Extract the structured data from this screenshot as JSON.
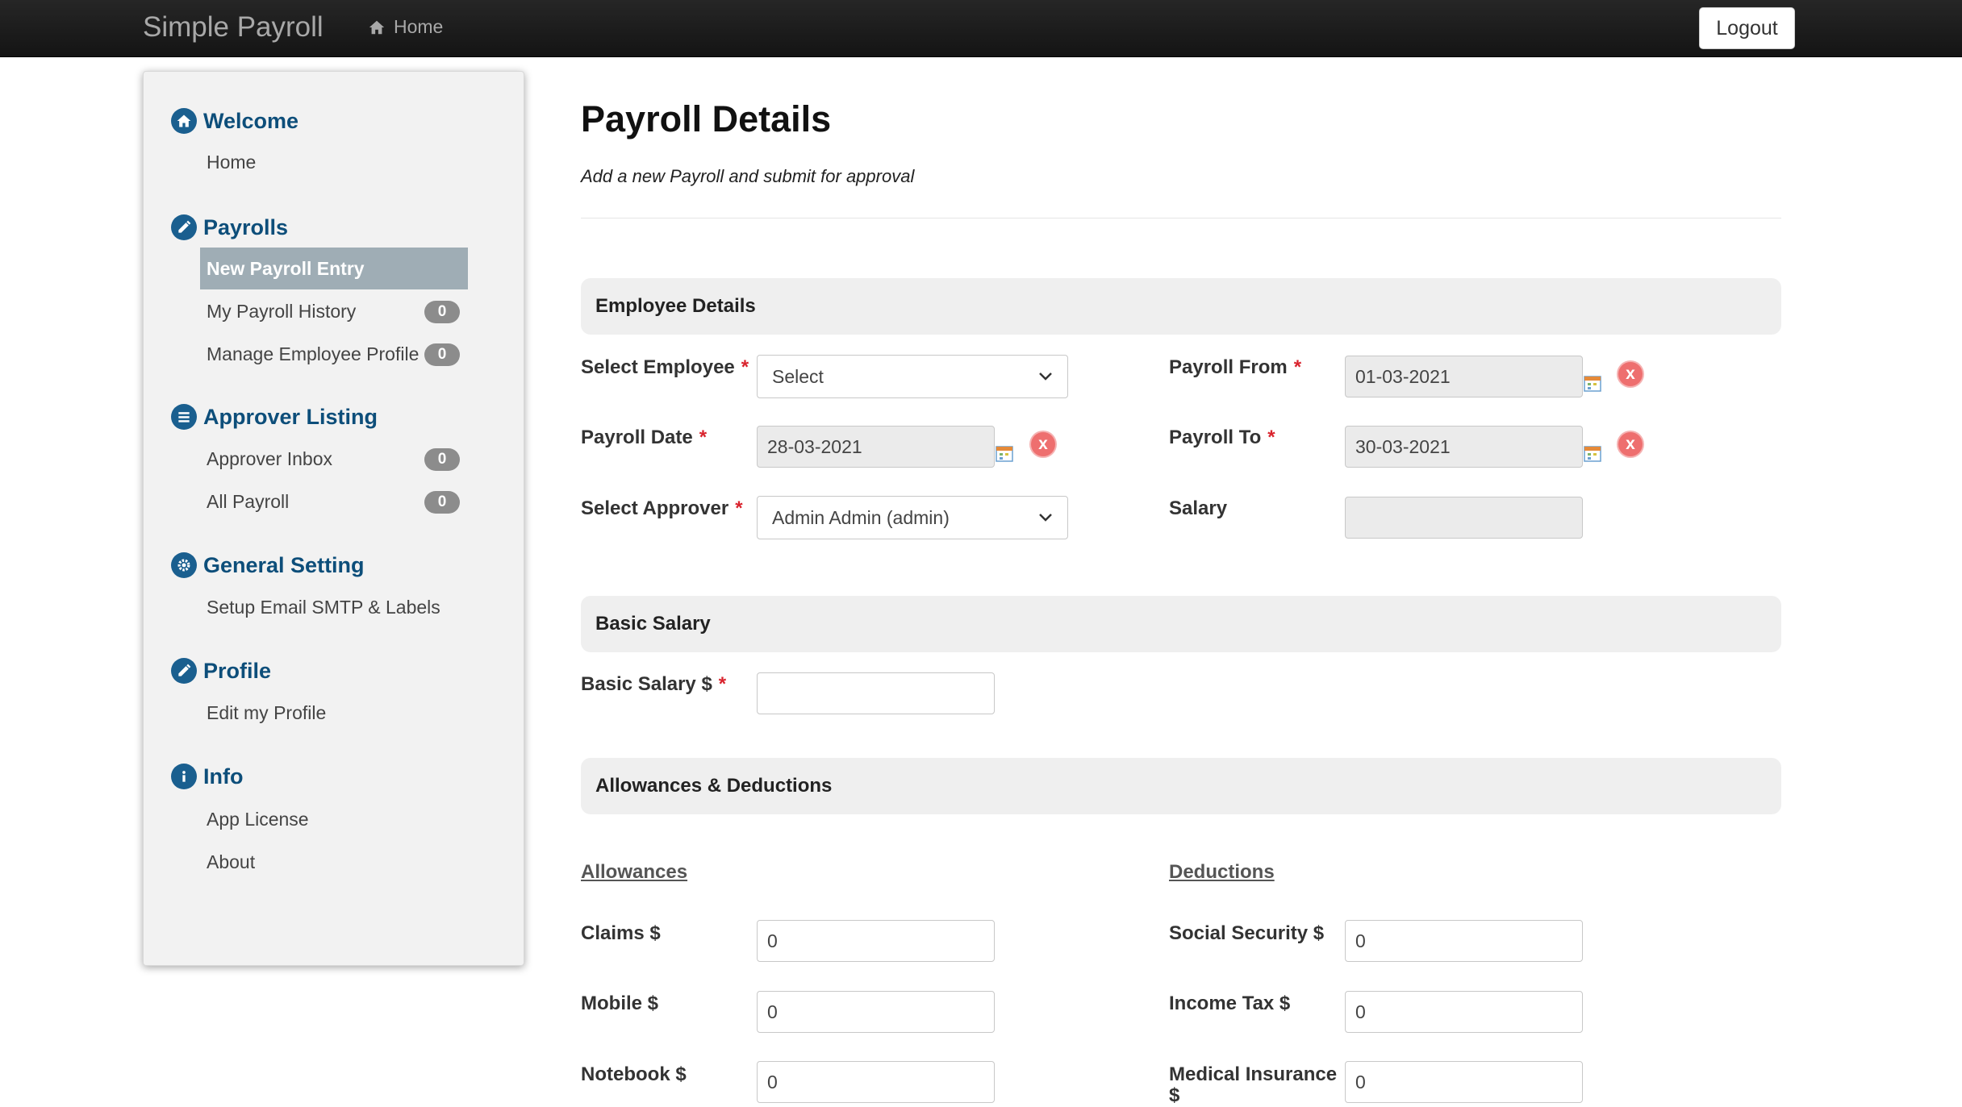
{
  "navbar": {
    "brand": "Simple Payroll",
    "home": "Home",
    "logout": "Logout"
  },
  "sidebar": {
    "welcome": {
      "title": "Welcome",
      "items": [
        "Home"
      ]
    },
    "payrolls": {
      "title": "Payrolls",
      "items": [
        {
          "label": "New Payroll Entry"
        },
        {
          "label": "My Payroll History",
          "badge": "0"
        },
        {
          "label": "Manage Employee Profile",
          "badge": "0"
        }
      ]
    },
    "approver": {
      "title": "Approver Listing",
      "items": [
        {
          "label": "Approver Inbox",
          "badge": "0"
        },
        {
          "label": "All Payroll",
          "badge": "0"
        }
      ]
    },
    "general": {
      "title": "General Setting",
      "items": [
        "Setup Email SMTP & Labels"
      ]
    },
    "profile": {
      "title": "Profile",
      "items": [
        "Edit my Profile"
      ]
    },
    "info": {
      "title": "Info",
      "items": [
        "App License",
        "About"
      ]
    }
  },
  "page": {
    "title": "Payroll Details",
    "subtitle": "Add a new Payroll and submit for approval"
  },
  "employee": {
    "heading": "Employee Details",
    "select_employee_label": "Select Employee",
    "select_employee_value": "Select",
    "payroll_date_label": "Payroll Date",
    "payroll_date_value": "28-03-2021",
    "select_approver_label": "Select Approver",
    "select_approver_value": "Admin Admin (admin)",
    "payroll_from_label": "Payroll From",
    "payroll_from_value": "01-03-2021",
    "payroll_to_label": "Payroll To",
    "payroll_to_value": "30-03-2021",
    "salary_label": "Salary",
    "salary_value": ""
  },
  "basic": {
    "heading": "Basic Salary",
    "label": "Basic Salary $",
    "value": ""
  },
  "allow_deduct": {
    "heading": "Allowances & Deductions",
    "allowances_title": "Allowances",
    "deductions_title": "Deductions",
    "allowances": [
      {
        "label": "Claims $",
        "value": "0"
      },
      {
        "label": "Mobile $",
        "value": "0"
      },
      {
        "label": "Notebook $",
        "value": "0"
      }
    ],
    "deductions": [
      {
        "label": "Social Security $",
        "value": "0"
      },
      {
        "label": "Income Tax $",
        "value": "0"
      },
      {
        "label": "Medical Insurance $",
        "value": "0"
      }
    ]
  },
  "required_mark": "*",
  "clear_glyph": "x",
  "colors": {
    "accent": "#0d4e7a",
    "active_bg": "#9fadb5",
    "required": "#d9232d",
    "clear": "#ee6f6f"
  }
}
